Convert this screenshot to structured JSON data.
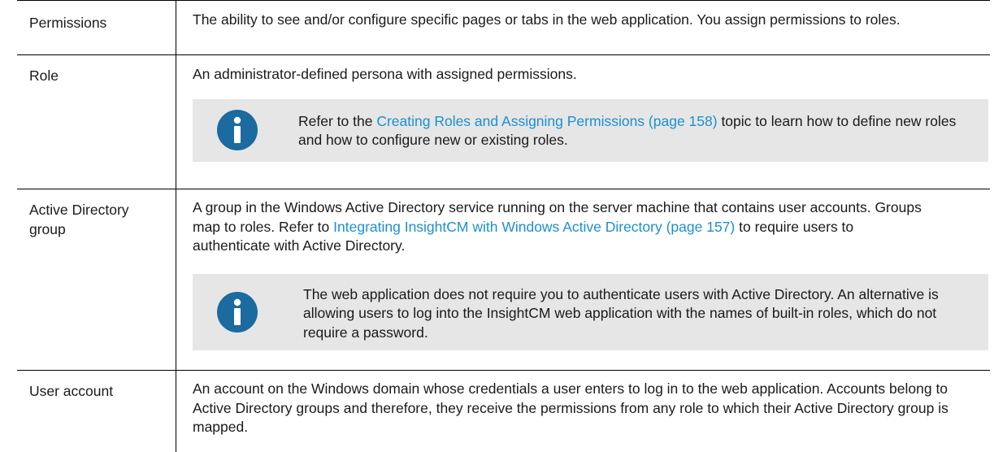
{
  "rows": [
    {
      "term": "Permissions",
      "definition": "The ability to see and/or configure specific pages or tabs in the web application. You assign permissions to roles."
    },
    {
      "term": "Role",
      "definition": "An administrator-defined persona with assigned permissions.",
      "note": {
        "before": "Refer to the ",
        "link": "Creating Roles and Assigning Permissions (page 158)",
        "after": " topic to learn how to define new roles and how to configure new or existing roles."
      }
    },
    {
      "term": "Active Directory group",
      "definition_before": "A group in the Windows Active Directory service running on the server machine that contains user accounts. Groups map to roles. Refer to ",
      "definition_link": "Integrating InsightCM with Windows Active Directory (page 157)",
      "definition_after": " to require users to authenticate with Active Directory.",
      "note": {
        "text": "The web application does not require you to authenticate users with Active Directory. An alternative is allowing users to log into the InsightCM web application with the names of built-in roles, which do not require a password."
      }
    },
    {
      "term": "User account",
      "definition": "An account on the Windows domain whose credentials a user enters to log in to the web application. Accounts belong to Active Directory groups and therefore, they receive the permissions from any role to which their Active Directory group is mapped."
    }
  ],
  "colors": {
    "link": "#1d8fd0",
    "note_background": "#e6e6e6",
    "info_icon": "#1b6aa0"
  },
  "icons": [
    "info-icon",
    "info-icon"
  ]
}
